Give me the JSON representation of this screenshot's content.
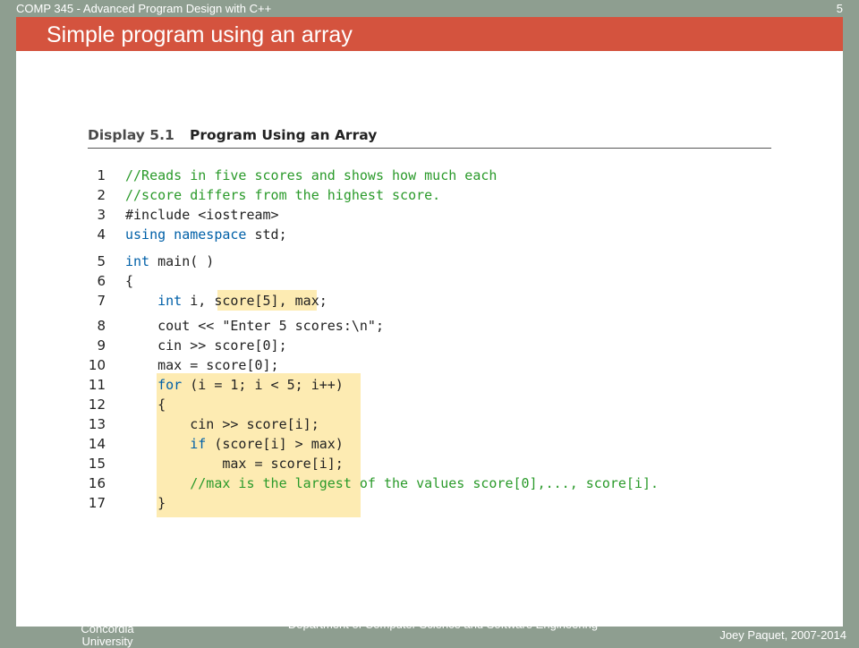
{
  "header": {
    "course": "COMP 345 - Advanced Program Design with C++",
    "slide_number": "5"
  },
  "slide": {
    "title": "Simple program using an array"
  },
  "display": {
    "label": "Display 5.1",
    "title": "Program Using an Array"
  },
  "code": {
    "lines": [
      {
        "num": "1",
        "segments": [
          {
            "t": "//Reads in five scores and shows how much each",
            "c": "cm"
          }
        ]
      },
      {
        "num": "2",
        "segments": [
          {
            "t": "//score differs from the highest score.",
            "c": "cm"
          }
        ]
      },
      {
        "num": "3",
        "segments": [
          {
            "t": "#include <iostream>",
            "c": ""
          }
        ]
      },
      {
        "num": "4",
        "segments": [
          {
            "t": "using namespace",
            "c": "kw"
          },
          {
            "t": " std;",
            "c": ""
          }
        ]
      },
      {
        "num": "5",
        "segments": [
          {
            "t": "int",
            "c": "kw"
          },
          {
            "t": " main( )",
            "c": ""
          }
        ]
      },
      {
        "num": "6",
        "segments": [
          {
            "t": "{",
            "c": ""
          }
        ]
      },
      {
        "num": "7",
        "segments": [
          {
            "t": "    ",
            "c": ""
          },
          {
            "t": "int",
            "c": "kw"
          },
          {
            "t": " i, score[5], max;",
            "c": ""
          }
        ]
      },
      {
        "num": "8",
        "segments": [
          {
            "t": "    cout << \"Enter 5 scores:\\n\";",
            "c": ""
          }
        ]
      },
      {
        "num": "9",
        "segments": [
          {
            "t": "    cin >> score[0];",
            "c": ""
          }
        ]
      },
      {
        "num": "10",
        "segments": [
          {
            "t": "    max = score[0];",
            "c": ""
          }
        ]
      },
      {
        "num": "11",
        "segments": [
          {
            "t": "    ",
            "c": ""
          },
          {
            "t": "for",
            "c": "kw"
          },
          {
            "t": " (i = 1; i < 5; i++)",
            "c": ""
          }
        ]
      },
      {
        "num": "12",
        "segments": [
          {
            "t": "    {",
            "c": ""
          }
        ]
      },
      {
        "num": "13",
        "segments": [
          {
            "t": "        cin >> score[i];",
            "c": ""
          }
        ]
      },
      {
        "num": "14",
        "segments": [
          {
            "t": "        ",
            "c": ""
          },
          {
            "t": "if",
            "c": "kw"
          },
          {
            "t": " (score[i] > max)",
            "c": ""
          }
        ]
      },
      {
        "num": "15",
        "segments": [
          {
            "t": "            max = score[i];",
            "c": ""
          }
        ]
      },
      {
        "num": "16",
        "segments": [
          {
            "t": "        ",
            "c": ""
          },
          {
            "t": "//max is the largest of the values score[0],..., score[i].",
            "c": "cm"
          }
        ]
      },
      {
        "num": "17",
        "segments": [
          {
            "t": "    }",
            "c": ""
          }
        ]
      }
    ]
  },
  "footer": {
    "left": "Concordia University",
    "center": "Department of Computer Science and Software Engineering",
    "right": "Joey Paquet, 2007-2014"
  },
  "colors": {
    "title_bar": "#d4533e",
    "background": "#8e9e90",
    "highlight": "#fdebb2",
    "keyword": "#0060a8",
    "comment": "#2a9a2a"
  }
}
